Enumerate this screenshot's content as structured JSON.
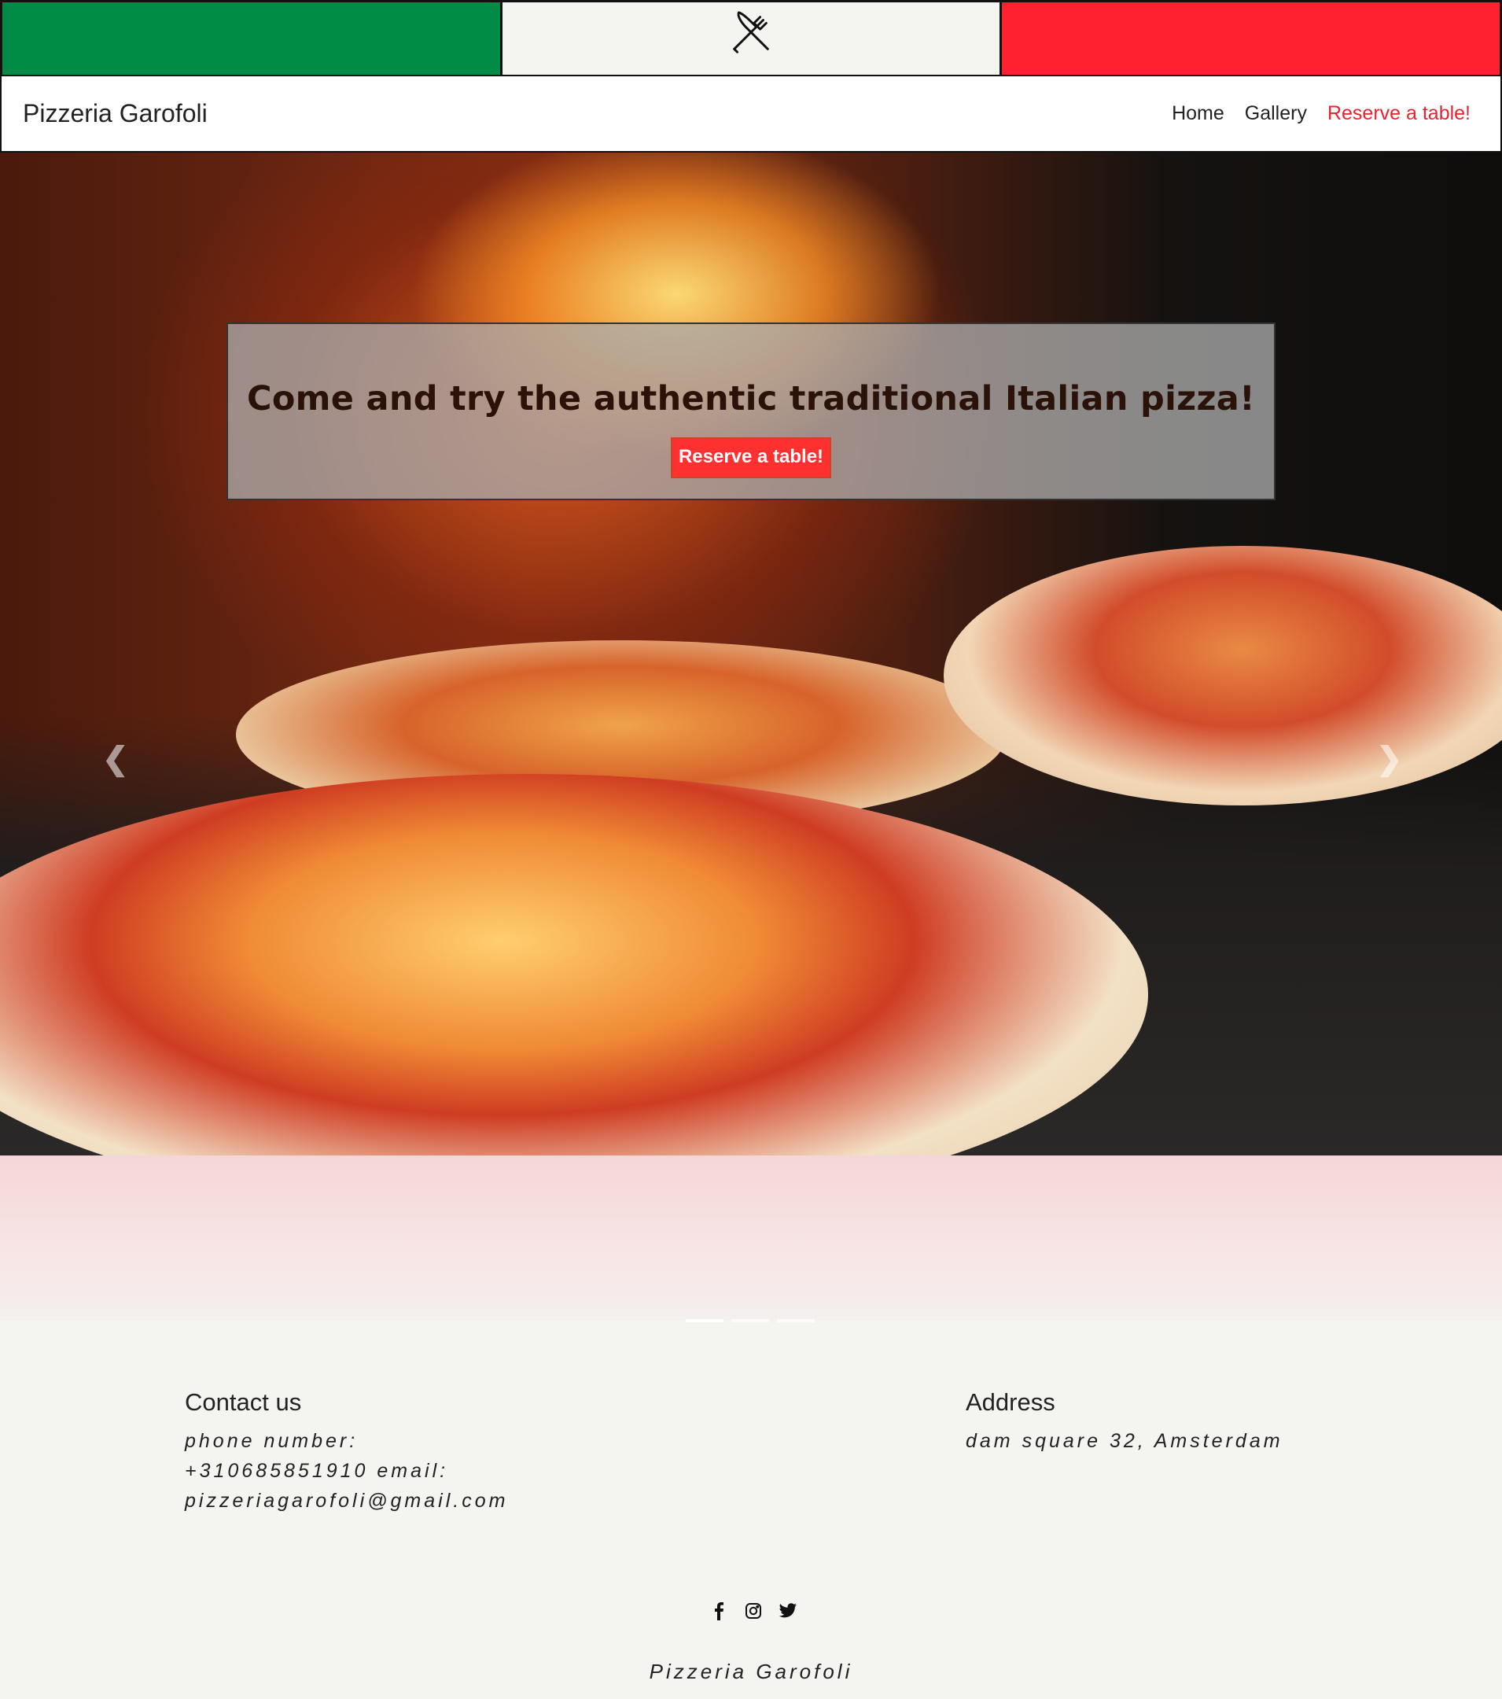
{
  "colors": {
    "flag_green": "#008c45",
    "flag_white": "#f4f4f0",
    "flag_red": "#ff212f",
    "accent": "#e8232f"
  },
  "flag": {
    "center_icon": "fork-knife-icon"
  },
  "navbar": {
    "brand": "Pizzeria Garofoli",
    "links": [
      {
        "label": "Home"
      },
      {
        "label": "Gallery"
      },
      {
        "label": "Reserve a table!",
        "active": true
      }
    ]
  },
  "hero": {
    "headline": "Come and try the authentic traditional Italian pizza!",
    "cta_label": "Reserve a table!",
    "prev_icon": "chevron-left-icon",
    "next_icon": "chevron-right-icon",
    "slide_count": 3,
    "active_slide": 1
  },
  "contact": {
    "title": "Contact us",
    "text": "phone number: +310685851910 email: pizzeriagarofoli@gmail.com"
  },
  "address": {
    "title": "Address",
    "text": "dam square 32, Amsterdam"
  },
  "socials": [
    "facebook-icon",
    "instagram-icon",
    "twitter-icon"
  ],
  "footer": {
    "name": "Pizzeria Garofoli"
  }
}
